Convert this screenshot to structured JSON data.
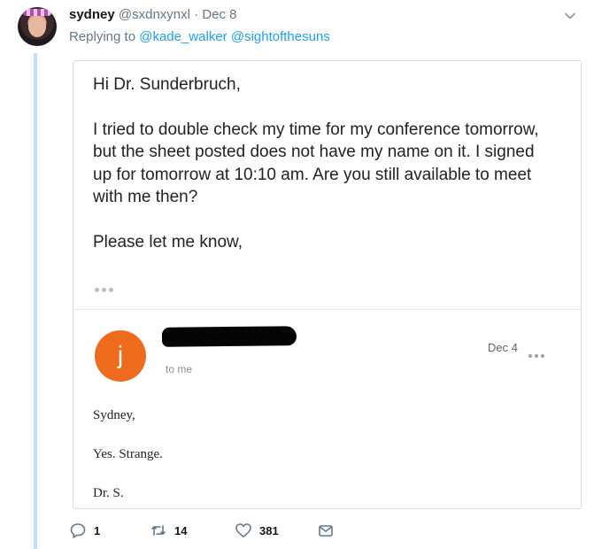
{
  "tweet": {
    "display_name": "sydney",
    "handle": "@sxdnxynxl",
    "separator": "·",
    "date": "Dec 8",
    "replying_prefix": "Replying to",
    "replying_to": [
      "@kade_walker",
      "@sightofthesuns"
    ]
  },
  "email": {
    "greeting": "Hi Dr. Sunderbruch,",
    "body": "I tried to double check my time for my conference tomorrow, but the sheet posted does not have my name on it. I signed up for tomorrow at 10:10 am. Are you still available to meet with me then?",
    "closing": "Please let me know,"
  },
  "reply": {
    "sender_initial": "j",
    "recipient": "to me",
    "date": "Dec 4",
    "lines": [
      "Sydney,",
      "Yes. Strange.",
      "Dr. S."
    ]
  },
  "actions": {
    "reply_count": "1",
    "retweet_count": "14",
    "like_count": "381"
  },
  "colors": {
    "link": "#1da1f2",
    "thread_line": "#c4dff7",
    "sender_avatar": "#ee6a1c",
    "meta_gray": "#657786"
  }
}
